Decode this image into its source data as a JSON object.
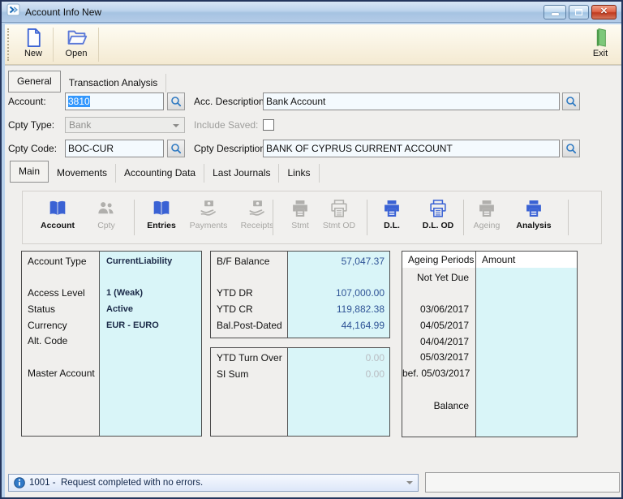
{
  "window": {
    "title": "Account Info New",
    "controls": {
      "minimize": "minimize",
      "maximize": "maximize",
      "close": "close"
    }
  },
  "toolbar": {
    "new_label": "New",
    "open_label": "Open",
    "exit_label": "Exit"
  },
  "tabs": {
    "general": "General",
    "transaction_analysis": "Transaction Analysis"
  },
  "form": {
    "account_label": "Account:",
    "account_value": "3810",
    "acc_description_label": "Acc. Description:",
    "acc_description_value": "Bank Account",
    "cpty_type_label": "Cpty Type:",
    "cpty_type_value": "Bank",
    "include_saved_label": "Include Saved:",
    "include_saved_checked": false,
    "cpty_code_label": "Cpty Code:",
    "cpty_code_value": "BOC-CUR",
    "cpty_description_label": "Cpty Description:",
    "cpty_description_value": "BANK OF CYPRUS CURRENT ACCOUNT"
  },
  "subtabs": [
    {
      "label": "Main",
      "active": true
    },
    {
      "label": "Movements",
      "active": false
    },
    {
      "label": "Accounting Data",
      "active": false
    },
    {
      "label": "Last Journals",
      "active": false
    },
    {
      "label": "Links",
      "active": false
    }
  ],
  "actions": [
    {
      "label": "Account",
      "icon": "book-icon",
      "enabled": true
    },
    {
      "label": "Cpty",
      "icon": "people-icon",
      "enabled": false
    },
    {
      "label": "Entries",
      "icon": "book-icon",
      "enabled": true
    },
    {
      "label": "Payments",
      "icon": "hand-coin-icon",
      "enabled": false
    },
    {
      "label": "Receipts",
      "icon": "hand-coin-icon",
      "enabled": false
    },
    {
      "label": "Stmt",
      "icon": "printer-icon",
      "enabled": false
    },
    {
      "label": "Stmt OD",
      "icon": "printer-outline-icon",
      "enabled": false
    },
    {
      "label": "D.L.",
      "icon": "printer-icon",
      "enabled": true
    },
    {
      "label": "D.L. OD",
      "icon": "printer-outline-icon",
      "enabled": true
    },
    {
      "label": "Ageing",
      "icon": "printer-icon",
      "enabled": false
    },
    {
      "label": "Analysis",
      "icon": "printer-icon",
      "enabled": true
    }
  ],
  "account_panel": {
    "rows": [
      {
        "label": "Account Type",
        "value": "CurrentLiability"
      },
      {
        "label": "",
        "value": ""
      },
      {
        "label": "Access Level",
        "value": "1 (Weak)"
      },
      {
        "label": "Status",
        "value": "Active"
      },
      {
        "label": "Currency",
        "value": "EUR - EURO"
      },
      {
        "label": "Alt. Code",
        "value": ""
      },
      {
        "label": "",
        "value": ""
      },
      {
        "label": "Master Account",
        "value": ""
      }
    ]
  },
  "balance_panel": {
    "rows": [
      {
        "label": "B/F Balance",
        "value": "57,047.37"
      },
      {
        "label": "",
        "value": ""
      },
      {
        "label": "YTD DR",
        "value": "107,000.00"
      },
      {
        "label": "YTD CR",
        "value": "119,882.38"
      },
      {
        "label": "Bal.Post-Dated",
        "value": "44,164.99"
      }
    ]
  },
  "turnover_panel": {
    "rows": [
      {
        "label": "YTD Turn Over",
        "value": "0.00"
      },
      {
        "label": "SI Sum",
        "value": "0.00"
      }
    ]
  },
  "ageing_panel": {
    "headers": [
      "Ageing Periods",
      "Amount"
    ],
    "rows": [
      {
        "period": "Not Yet Due",
        "amount": ""
      },
      {
        "period": "",
        "amount": ""
      },
      {
        "period": "03/06/2017",
        "amount": ""
      },
      {
        "period": "04/05/2017",
        "amount": ""
      },
      {
        "period": "04/04/2017",
        "amount": ""
      },
      {
        "period": "05/03/2017",
        "amount": ""
      },
      {
        "period": "bef. 05/03/2017",
        "amount": ""
      },
      {
        "period": "",
        "amount": ""
      },
      {
        "period": "Balance",
        "amount": ""
      }
    ]
  },
  "statusbar": {
    "message": "1001 -  Request completed with no errors."
  },
  "colors": {
    "accent_blue": "#3a62d4",
    "disabled_icon_grey": "#b0afac",
    "value_blue": "#2f5496",
    "cyan_background": "#d9f5f8",
    "selection_blue": "#3297fd",
    "toolbar_cream": "#f4ead2",
    "titlebar_blue": "#bcd3ec",
    "exit_green": "#7dc87a"
  }
}
